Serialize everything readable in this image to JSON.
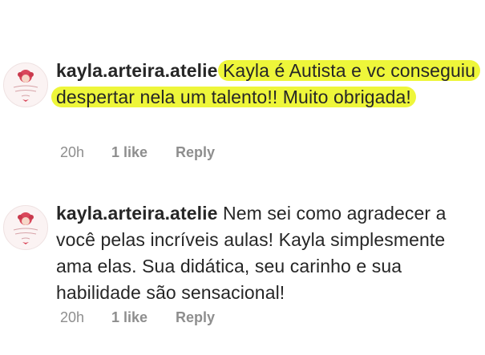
{
  "comments": [
    {
      "username": "kayla.arteira.atelie",
      "text_highlighted": "Kayla é Autista e vc conseguiu despertar nela um talento!! Muito obrigada!",
      "time": "20h",
      "likes": "1 like",
      "reply_label": "Reply",
      "highlight_color": "#eef63a"
    },
    {
      "username": "kayla.arteira.atelie",
      "text": "Nem sei como agradecer a você pelas incríveis aulas! Kayla simplesmente ama elas. Sua didática, seu carinho e sua habilidade  são sensacional!",
      "time": "20h",
      "likes": "1 like",
      "reply_label": "Reply"
    }
  ],
  "avatar_icon": "doll-logo-icon"
}
